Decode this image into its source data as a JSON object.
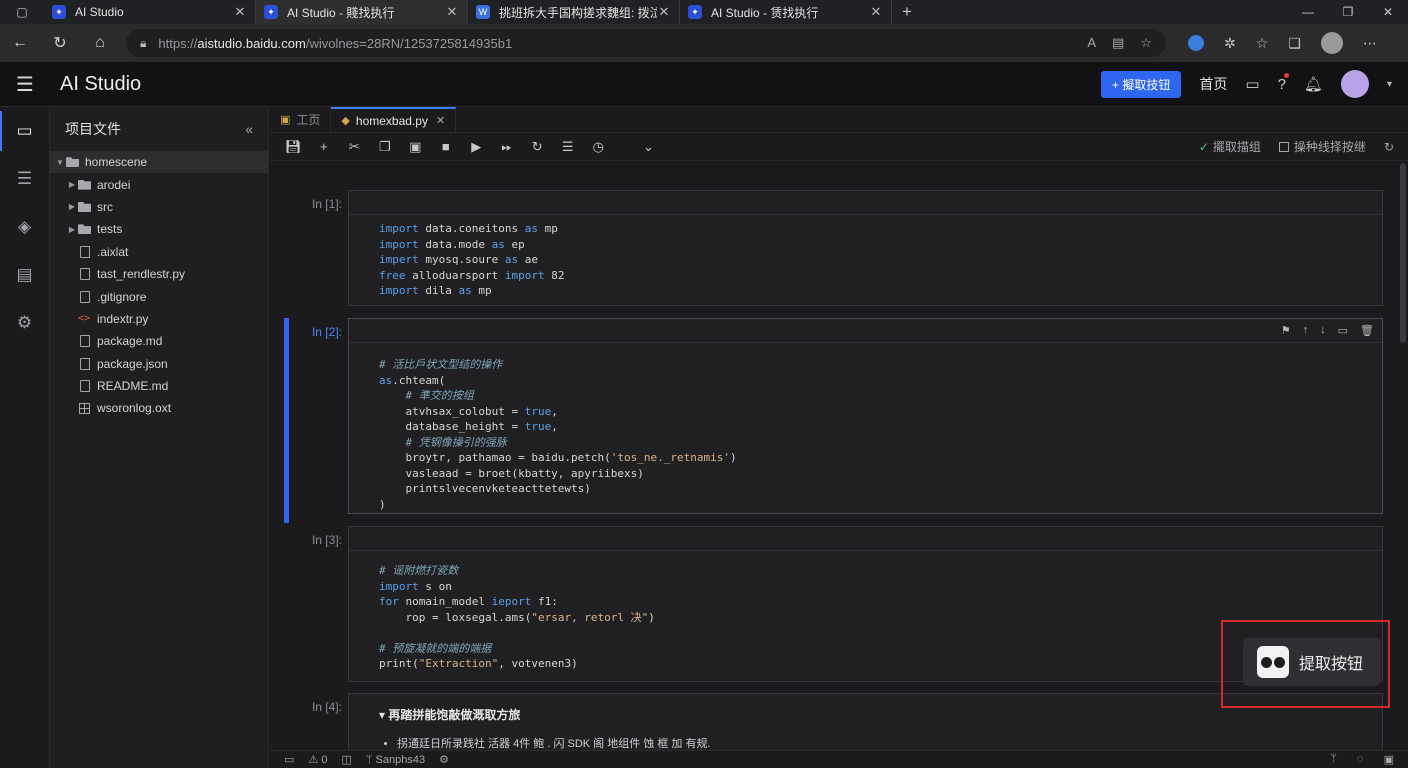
{
  "browser": {
    "tabs": [
      {
        "title": "AI Studio",
        "active": false
      },
      {
        "title": "AI Studio - 賤找执行",
        "active": true
      },
      {
        "title": "挑班拆大手国构搓求魏组: 拨泣",
        "active": false
      },
      {
        "title": "AI Studio - 赁找执行",
        "active": false
      }
    ],
    "url_prefix": "https://",
    "url_host": "aistudio.baidu.com",
    "url_path": "/wivolnes=28RN/1253725814935b1"
  },
  "header": {
    "app_title": "AI Studio",
    "primary_button": "+ 擬取技钮",
    "home_link": "首页"
  },
  "explorer": {
    "title": "项目文件",
    "items": [
      {
        "name": "homescene",
        "type": "folder",
        "depth": 0,
        "expanded": true
      },
      {
        "name": "arodei",
        "type": "folder",
        "depth": 1
      },
      {
        "name": "src",
        "type": "folder",
        "depth": 1
      },
      {
        "name": "tests",
        "type": "folder",
        "depth": 1
      },
      {
        "name": ".aixlat",
        "type": "file",
        "depth": 1
      },
      {
        "name": "tast_rendlestr.py",
        "type": "file",
        "depth": 1
      },
      {
        "name": ".gitignore",
        "type": "file",
        "depth": 1
      },
      {
        "name": "indextr.py",
        "type": "code",
        "depth": 1
      },
      {
        "name": "package.md",
        "type": "file",
        "depth": 1
      },
      {
        "name": "package.json",
        "type": "file",
        "depth": 1
      },
      {
        "name": "README.md",
        "type": "file",
        "depth": 1
      },
      {
        "name": "wsoronlog.oxt",
        "type": "grid",
        "depth": 1
      }
    ]
  },
  "editor": {
    "tabs": [
      {
        "label": "工页",
        "active": false
      },
      {
        "label": "homexbad.py",
        "active": true
      }
    ],
    "toolbar_right": {
      "saved_label": "擺取描组",
      "checkbox_label": "操种线择按继"
    }
  },
  "cells": [
    {
      "prompt": "In [1]:",
      "lines": [
        "import data.coneitons as mp",
        "import data.mode as ep",
        "impert myosq.soure as ae",
        "free alloduarsport import 82",
        "import dila as mp"
      ]
    },
    {
      "prompt": "In [2]:",
      "lines": [
        "# 活比戶状文型结的操作",
        "as.chteam(",
        "    # 準交的按组",
        "    atvhsax_colobut = true,",
        "    database_height = true,",
        "    # 凭钢像操引的强脉",
        "    broytr, pathamao = baidu.petch('tos_ne._retnamis')",
        "    vasleaad = broet(kbatty, apyriibexs)",
        "    printslvecenvketeacttetewts)",
        ")"
      ]
    },
    {
      "prompt": "In [3]:",
      "lines": [
        "# 谣附燃打瓷数",
        "import s on",
        "for nomain_model ieport f1:",
        "    rop = loxsegal.ams(\"ersar, retorl 决\")",
        "",
        "# 预旋凝就的端的端据",
        "print(\"Extraction\", votvenen3)"
      ]
    },
    {
      "prompt": "In [4]:",
      "md_heading": "▾ 再踏拼能饱敲做溉取方旅",
      "md_bullet": "拐通廷日所录践社 活器 4件 鲍 . 闪 SDK 阁 地组件 蚀 框 加 有规."
    }
  ],
  "status": {
    "errors": "0",
    "branch": "Sanphs43"
  },
  "floating_button": {
    "label": "提取按钮"
  }
}
